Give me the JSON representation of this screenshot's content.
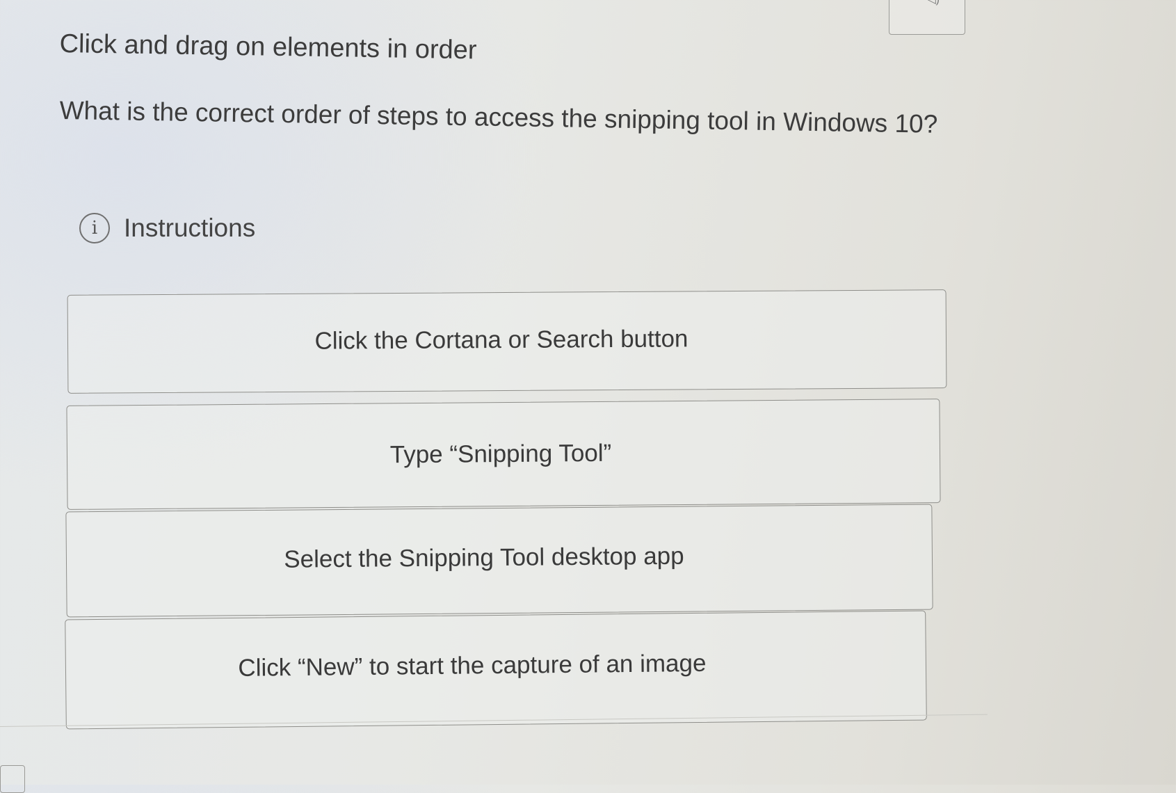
{
  "prompt": "Click and drag on elements in order",
  "question": "What is the correct order of steps to access the snipping tool in Windows 10?",
  "instructions": {
    "icon": "info-icon",
    "icon_glyph": "i",
    "label": "Instructions"
  },
  "steps": [
    {
      "label": "Click the Cortana or Search button"
    },
    {
      "label": "Type “Snipping Tool”"
    },
    {
      "label": "Select the Snipping Tool desktop app"
    },
    {
      "label": "Click “New” to start the capture of an image"
    }
  ]
}
